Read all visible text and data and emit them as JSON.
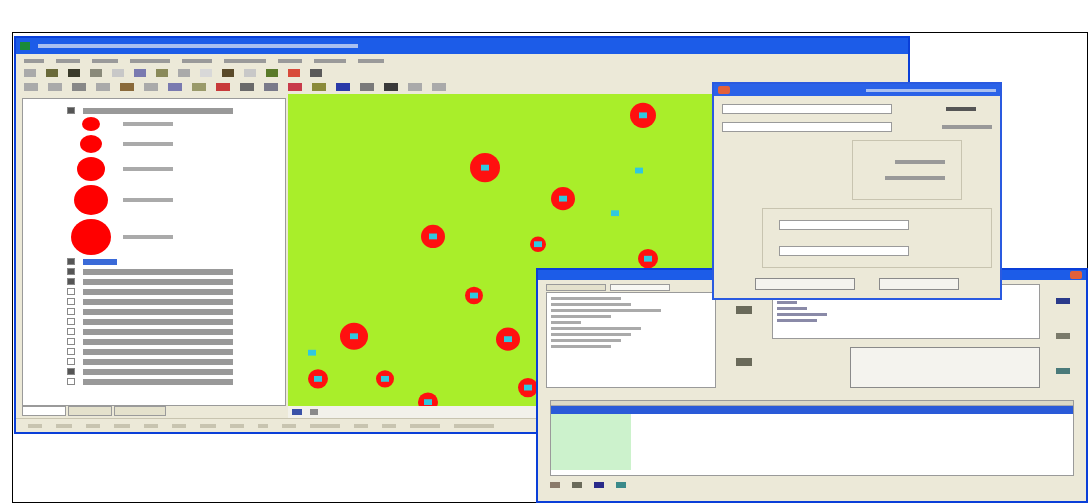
{
  "main_window": {
    "toc": {
      "layers": [
        {
          "checked": true,
          "selected": false
        },
        {
          "checked": true,
          "selected": true
        },
        {
          "checked": true,
          "selected": false
        },
        {
          "checked": true,
          "selected": false
        },
        {
          "checked": false,
          "selected": false
        },
        {
          "checked": false,
          "selected": false
        },
        {
          "checked": false,
          "selected": false
        },
        {
          "checked": false,
          "selected": false
        },
        {
          "checked": false,
          "selected": false
        },
        {
          "checked": false,
          "selected": false
        },
        {
          "checked": false,
          "selected": false
        },
        {
          "checked": false,
          "selected": false
        },
        {
          "checked": true,
          "selected": false
        },
        {
          "checked": false,
          "selected": false
        }
      ],
      "tabs": [
        {
          "selected": true
        },
        {
          "selected": false
        },
        {
          "selected": false
        }
      ]
    }
  },
  "table_window": {
    "rows": [
      {
        "selected": true
      },
      {
        "selected": false
      },
      {
        "selected": false
      },
      {
        "selected": false
      },
      {
        "selected": false
      },
      {
        "selected": false
      },
      {
        "selected": false
      },
      {
        "selected": false
      }
    ],
    "tabs": [
      {
        "selected": false
      },
      {
        "selected": true
      }
    ]
  }
}
